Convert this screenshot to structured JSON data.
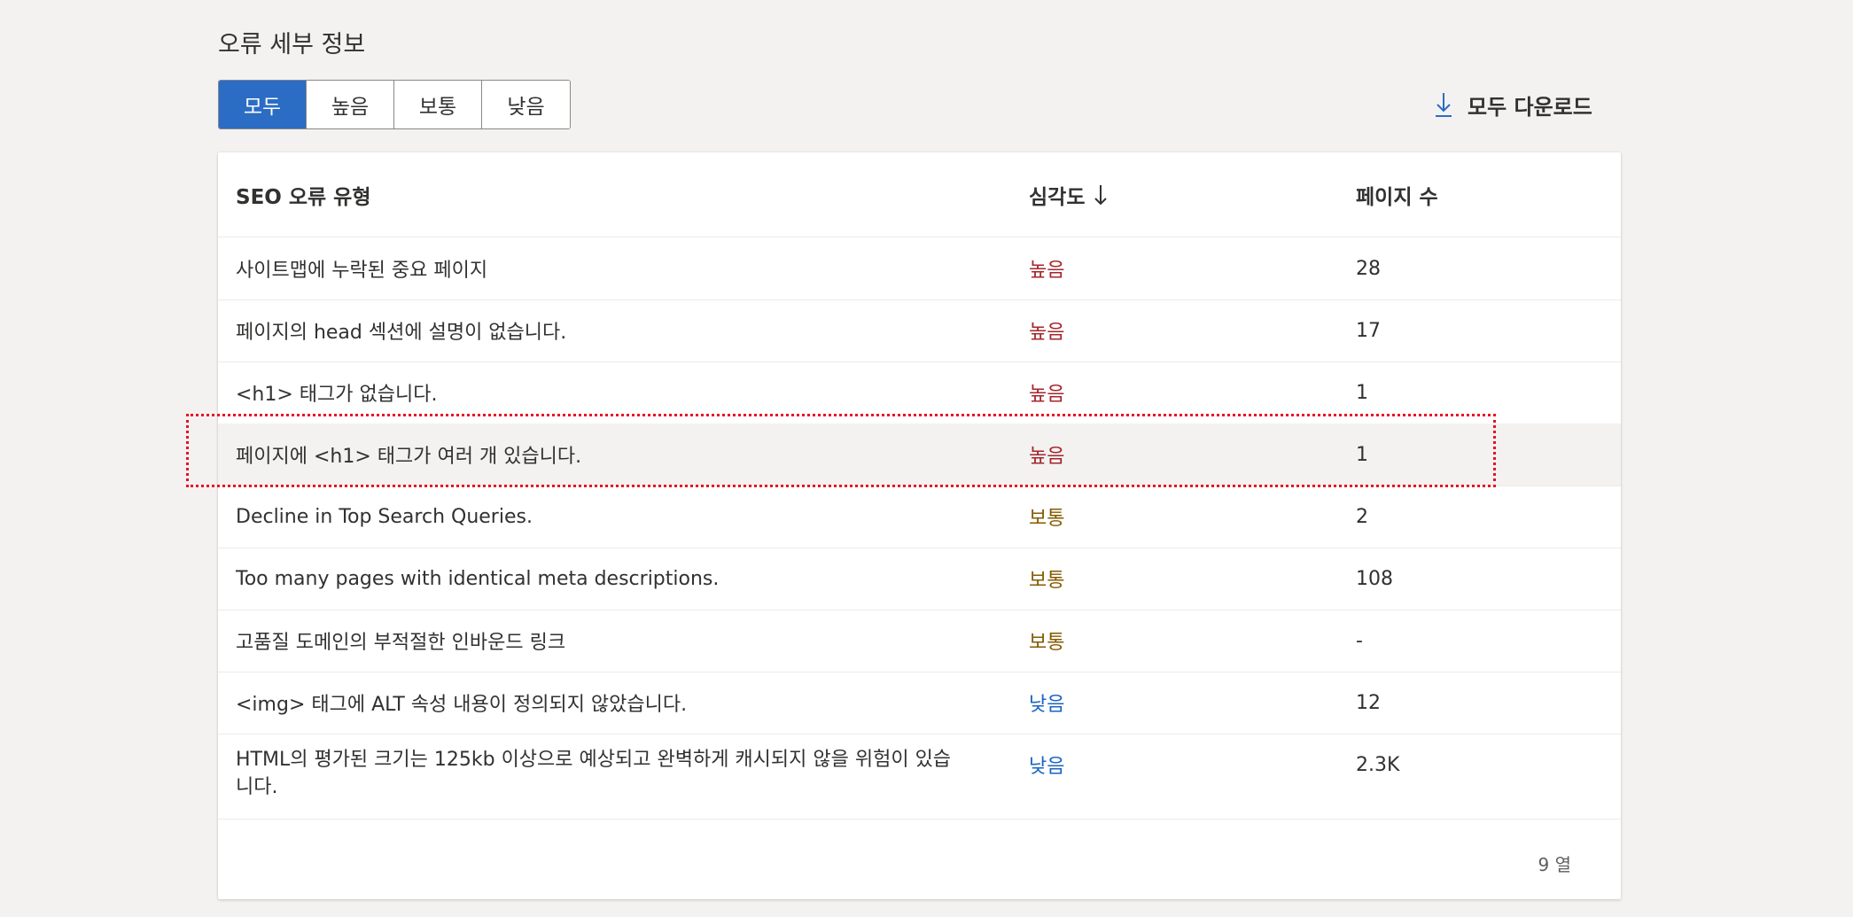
{
  "section_title": "오류 세부 정보",
  "filters": [
    {
      "label": "모두",
      "active": true
    },
    {
      "label": "높음",
      "active": false
    },
    {
      "label": "보통",
      "active": false
    },
    {
      "label": "낮음",
      "active": false
    }
  ],
  "download_all_label": "모두 다운로드",
  "table": {
    "headers": {
      "error_type": "SEO 오류 유형",
      "severity": "심각도",
      "page_count": "페이지 수"
    },
    "sort": {
      "column": "severity",
      "direction": "descending",
      "icon": "arrow-down-icon"
    },
    "rows": [
      {
        "error_type": "사이트맵에 누락된 중요 페이지",
        "severity": "높음",
        "page_count": "28"
      },
      {
        "error_type": "페이지의 head 섹션에 설명이 없습니다.",
        "severity": "높음",
        "page_count": "17"
      },
      {
        "error_type": "<h1> 태그가 없습니다.",
        "severity": "높음",
        "page_count": "1"
      },
      {
        "error_type": "페이지에 <h1> 태그가 여러 개 있습니다.",
        "severity": "높음",
        "page_count": "1"
      },
      {
        "error_type": "Decline in Top Search Queries.",
        "severity": "보통",
        "page_count": "2"
      },
      {
        "error_type": "Too many pages with identical meta descriptions.",
        "severity": "보통",
        "page_count": "108"
      },
      {
        "error_type": "고품질 도메인의 부적절한 인바운드 링크",
        "severity": "보통",
        "page_count": "-"
      },
      {
        "error_type": "<img> 태그에 ALT 속성 내용이 정의되지 않았습니다.",
        "severity": "낮음",
        "page_count": "12"
      },
      {
        "error_type": "HTML의 평가된 크기는 125kb 이상으로 예상되고 완벽하게 캐시되지 않을 위험이 있습니다.",
        "severity": "낮음",
        "page_count": "2.3K"
      }
    ],
    "row_count_label": "9 열"
  },
  "colors": {
    "accent": "#2b6cc4",
    "severity_high": "#a4262c",
    "severity_medium": "#835b00",
    "severity_low": "#1a65c0",
    "highlight_outline": "#e81123"
  }
}
